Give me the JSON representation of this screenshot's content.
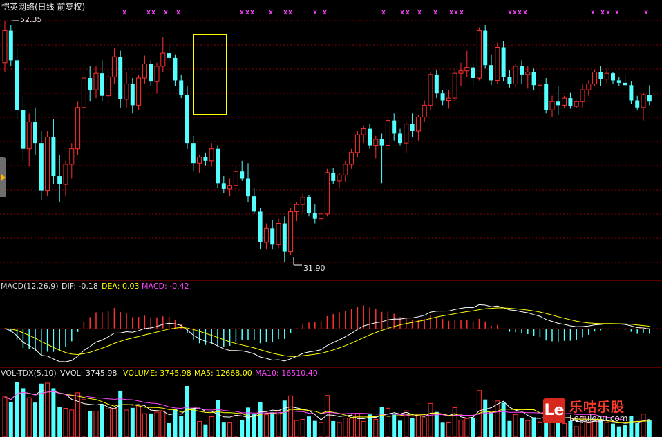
{
  "window": {
    "title": "恺英网络(日线 前复权)"
  },
  "price_panel": {
    "high_marker": "52.35",
    "low_marker": "31.90",
    "colors": {
      "up": "#ff3030",
      "down": "#54ffff",
      "grid": "#8b0000",
      "highlight": "#ffff00",
      "marker": "#ff44ff"
    }
  },
  "macd_panel": {
    "name": "MACD(12,26,9)",
    "dif": "DIF: -0.18",
    "dea": "DEA: 0.03",
    "macd": "MACD: -0.42"
  },
  "volume_panel": {
    "name": "VOL-TDX(5,10)",
    "vvol": "VVOL: 3745.98",
    "volume": "VOLUME: 3745.98",
    "ma5": "MA5: 12668.00",
    "ma10": "MA10: 16510.40"
  },
  "watermark": {
    "logo": "Le",
    "name_cn": "乐咕乐股",
    "url": "Legulegu.com"
  },
  "chart_data": {
    "type": "candlestick",
    "title": "恺英网络(日线 前复权)",
    "price_labels": {
      "high": 52.35,
      "low": 31.9
    },
    "candles_approx": [
      [
        48.8,
        52.35,
        48.0,
        51.5
      ],
      [
        51.5,
        52.0,
        48.5,
        49.0
      ],
      [
        49.0,
        50.0,
        44.0,
        44.8
      ],
      [
        44.8,
        46.0,
        40.5,
        41.5
      ],
      [
        41.5,
        44.5,
        40.0,
        43.8
      ],
      [
        43.8,
        45.0,
        41.0,
        42.0
      ],
      [
        42.0,
        43.0,
        37.2,
        38.0
      ],
      [
        38.0,
        43.0,
        37.5,
        42.5
      ],
      [
        42.5,
        44.0,
        38.5,
        39.2
      ],
      [
        39.2,
        41.0,
        37.0,
        38.5
      ],
      [
        38.5,
        40.5,
        37.5,
        40.2
      ],
      [
        40.2,
        42.0,
        39.0,
        41.5
      ],
      [
        41.5,
        45.5,
        41.0,
        45.0
      ],
      [
        45.0,
        48.0,
        44.0,
        47.5
      ],
      [
        47.5,
        48.5,
        45.5,
        46.5
      ],
      [
        46.5,
        48.5,
        45.8,
        47.9
      ],
      [
        47.9,
        49.0,
        45.5,
        46.0
      ],
      [
        46.0,
        48.2,
        45.2,
        47.6
      ],
      [
        47.6,
        50.0,
        47.0,
        49.3
      ],
      [
        49.3,
        49.8,
        45.0,
        45.7
      ],
      [
        45.7,
        48.0,
        45.0,
        47.0
      ],
      [
        47.0,
        47.5,
        44.5,
        45.2
      ],
      [
        45.2,
        47.8,
        44.8,
        47.5
      ],
      [
        47.5,
        49.4,
        47.0,
        48.7
      ],
      [
        48.7,
        49.0,
        46.8,
        47.2
      ],
      [
        47.2,
        48.8,
        46.2,
        48.5
      ],
      [
        48.5,
        51.0,
        48.0,
        49.6
      ],
      [
        49.6,
        50.2,
        48.9,
        49.2
      ],
      [
        49.2,
        49.5,
        46.8,
        47.3
      ],
      [
        47.3,
        47.8,
        45.8,
        46.1
      ],
      [
        46.1,
        46.8,
        41.5,
        42.0
      ],
      [
        42.0,
        42.6,
        39.6,
        40.3
      ],
      [
        40.3,
        41.0,
        39.5,
        40.8
      ],
      [
        40.8,
        41.2,
        40.1,
        40.5
      ],
      [
        40.5,
        42.0,
        40.0,
        41.5
      ],
      [
        41.5,
        41.8,
        38.2,
        38.6
      ],
      [
        38.6,
        39.2,
        37.8,
        38.1
      ],
      [
        38.1,
        39.0,
        37.5,
        38.4
      ],
      [
        38.4,
        40.1,
        38.0,
        39.6
      ],
      [
        39.6,
        40.5,
        38.8,
        39.0
      ],
      [
        39.0,
        40.3,
        37.0,
        37.5
      ],
      [
        37.5,
        38.2,
        36.0,
        36.2
      ],
      [
        36.2,
        36.5,
        33.0,
        33.6
      ],
      [
        33.6,
        35.2,
        33.0,
        34.8
      ],
      [
        34.8,
        35.5,
        33.0,
        33.4
      ],
      [
        33.4,
        35.6,
        33.1,
        35.2
      ],
      [
        35.2,
        35.8,
        31.9,
        32.8
      ],
      [
        32.8,
        36.5,
        32.5,
        36.2
      ],
      [
        36.2,
        37.0,
        35.4,
        36.8
      ],
      [
        36.8,
        37.8,
        36.0,
        37.4
      ],
      [
        37.4,
        37.6,
        35.8,
        36.1
      ],
      [
        36.1,
        36.8,
        35.2,
        35.6
      ],
      [
        35.6,
        36.3,
        34.9,
        36.0
      ],
      [
        36.0,
        39.8,
        35.8,
        39.5
      ],
      [
        39.5,
        39.9,
        38.5,
        38.8
      ],
      [
        38.8,
        39.5,
        38.2,
        39.3
      ],
      [
        39.3,
        40.5,
        38.7,
        40.2
      ],
      [
        40.2,
        41.5,
        39.8,
        41.2
      ],
      [
        41.2,
        43.0,
        40.8,
        42.7
      ],
      [
        42.7,
        43.5,
        42.0,
        43.2
      ],
      [
        43.2,
        43.6,
        41.5,
        41.8
      ],
      [
        41.8,
        42.6,
        40.7,
        42.3
      ],
      [
        42.3,
        42.8,
        38.6,
        41.8
      ],
      [
        41.8,
        44.2,
        41.5,
        43.9
      ],
      [
        43.9,
        44.5,
        42.2,
        42.8
      ],
      [
        42.8,
        43.2,
        41.8,
        42.0
      ],
      [
        42.0,
        43.8,
        41.2,
        43.6
      ],
      [
        43.6,
        44.5,
        42.5,
        43.0
      ],
      [
        43.0,
        44.4,
        42.2,
        44.2
      ],
      [
        44.2,
        45.6,
        43.8,
        45.2
      ],
      [
        45.2,
        48.0,
        44.8,
        47.8
      ],
      [
        47.8,
        48.2,
        45.8,
        46.2
      ],
      [
        46.2,
        46.5,
        45.2,
        45.6
      ],
      [
        45.6,
        46.5,
        44.9,
        45.8
      ],
      [
        45.8,
        48.3,
        45.5,
        47.9
      ],
      [
        47.9,
        48.8,
        46.8,
        48.1
      ],
      [
        48.1,
        49.8,
        47.6,
        48.4
      ],
      [
        48.4,
        48.8,
        46.9,
        47.5
      ],
      [
        47.5,
        51.8,
        47.3,
        51.5
      ],
      [
        51.5,
        52.0,
        48.3,
        48.6
      ],
      [
        48.6,
        49.5,
        46.9,
        47.3
      ],
      [
        47.3,
        50.5,
        47.0,
        50.1
      ],
      [
        50.1,
        50.6,
        47.2,
        47.6
      ],
      [
        47.6,
        48.2,
        46.7,
        47.0
      ],
      [
        47.0,
        48.7,
        46.7,
        48.5
      ],
      [
        48.5,
        49.0,
        47.0,
        47.8
      ],
      [
        47.8,
        48.5,
        46.6,
        48.0
      ],
      [
        48.0,
        48.3,
        46.5,
        46.9
      ],
      [
        46.9,
        47.2,
        45.5,
        47.0
      ],
      [
        47.0,
        47.5,
        44.5,
        44.8
      ],
      [
        44.8,
        46.0,
        44.2,
        45.5
      ],
      [
        45.5,
        46.8,
        44.4,
        45.2
      ],
      [
        45.2,
        46.0,
        45.0,
        45.8
      ],
      [
        45.8,
        46.3,
        44.9,
        45.1
      ],
      [
        45.1,
        45.6,
        45.0,
        45.5
      ],
      [
        45.5,
        47.0,
        45.0,
        46.5
      ],
      [
        46.5,
        47.3,
        46.0,
        47.0
      ],
      [
        47.0,
        48.2,
        46.8,
        48.0
      ],
      [
        48.0,
        48.5,
        46.8,
        47.4
      ],
      [
        47.4,
        48.3,
        47.0,
        47.9
      ],
      [
        47.9,
        48.0,
        47.0,
        47.3
      ],
      [
        47.3,
        47.6,
        46.8,
        47.1
      ],
      [
        47.1,
        47.8,
        46.7,
        46.9
      ],
      [
        46.9,
        47.2,
        45.3,
        45.6
      ],
      [
        45.6,
        46.0,
        44.8,
        45.0
      ],
      [
        45.0,
        46.3,
        43.9,
        46.1
      ],
      [
        46.1,
        46.9,
        45.2,
        45.5
      ]
    ]
  }
}
